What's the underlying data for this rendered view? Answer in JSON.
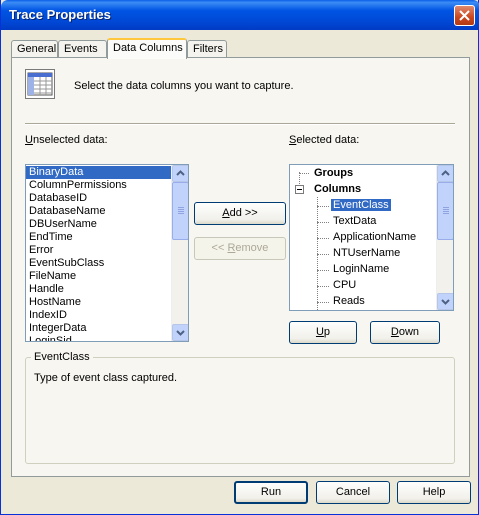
{
  "window": {
    "title": "Trace Properties"
  },
  "tabs": [
    {
      "label": "General"
    },
    {
      "label": "Events"
    },
    {
      "label": "Data Columns"
    },
    {
      "label": "Filters"
    }
  ],
  "header": {
    "instruction": "Select the data columns you want to capture."
  },
  "unselected": {
    "label_accel": "U",
    "label_rest": "nselected data:",
    "items": [
      "BinaryData",
      "ColumnPermissions",
      "DatabaseID",
      "DatabaseName",
      "DBUserName",
      "EndTime",
      "Error",
      "EventSubClass",
      "FileName",
      "Handle",
      "HostName",
      "IndexID",
      "IntegerData",
      "LoginSid"
    ],
    "selected": "BinaryData"
  },
  "selected_data": {
    "label_accel": "S",
    "label_rest": "elected data:",
    "groups_label": "Groups",
    "columns_label": "Columns",
    "columns": [
      "EventClass",
      "TextData",
      "ApplicationName",
      "NTUserName",
      "LoginName",
      "CPU",
      "Reads"
    ],
    "selected": "EventClass"
  },
  "buttons": {
    "add": {
      "accel": "A",
      "rest": "dd >>"
    },
    "remove": {
      "pre": "<< ",
      "accel": "R",
      "rest": "emove"
    },
    "up": {
      "accel": "U",
      "rest": "p"
    },
    "down": {
      "accel": "D",
      "rest": "own"
    },
    "run": "Run",
    "cancel": "Cancel",
    "help": "Help"
  },
  "description": {
    "title": "EventClass",
    "text": "Type of event class captured."
  },
  "colors": {
    "titlebar": "#0054e3",
    "selection": "#316ac5",
    "dialog_bg": "#ece9d8"
  },
  "icons": [
    "close-icon",
    "data-columns-grid-icon",
    "scroll-up-arrow-icon",
    "scroll-down-arrow-icon",
    "tree-collapse-icon"
  ]
}
